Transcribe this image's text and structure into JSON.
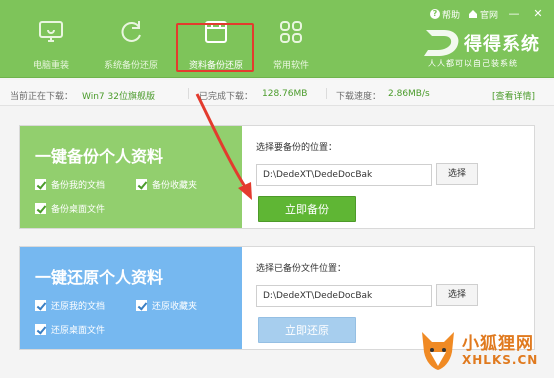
{
  "header": {
    "tools": [
      {
        "label": "电脑重装",
        "icon": "monitor-icon",
        "active": false
      },
      {
        "label": "系统备份还原",
        "icon": "refresh-icon",
        "active": false
      },
      {
        "label": "资料备份还原",
        "icon": "folder-icon",
        "active": true
      },
      {
        "label": "常用软件",
        "icon": "apps-grid-icon",
        "active": false
      }
    ],
    "topbar": {
      "help": "帮助",
      "site": "官网",
      "minimize": "—",
      "close": "✕"
    },
    "logo": {
      "main": "得得系统",
      "sub": "人人都可以自己装系统"
    }
  },
  "status": {
    "downloading_label": "当前正在下载：",
    "downloading_value": "Win7 32位旗舰版",
    "downloaded_label": "已完成下载：",
    "downloaded_value": "128.76MB",
    "speed_label": "下载速度：",
    "speed_value": "2.86MB/s",
    "detail_link": "[查看详情]"
  },
  "backup": {
    "title": "一键备份个人资料",
    "options": [
      "备份我的文档",
      "备份收藏夹",
      "备份桌面文件"
    ],
    "location_label": "选择要备份的位置：",
    "path": "D:\\DedeXT\\DedeDocBak",
    "choose_label": "选择",
    "action_label": "立即备份"
  },
  "restore": {
    "title": "一键还原个人资料",
    "options": [
      "还原我的文档",
      "还原收藏夹",
      "还原桌面文件"
    ],
    "location_label": "选择已备份文件位置：",
    "path": "D:\\DedeXT\\DedeDocBak",
    "choose_label": "选择",
    "action_label": "立即还原"
  },
  "watermark": {
    "cn": "小狐狸网",
    "en": "XHLKS.CN"
  },
  "colors": {
    "header_green": "#7ec45a",
    "backup_green": "#92cf6e",
    "restore_blue": "#76b8f0",
    "highlight_red": "#e33b2e",
    "watermark_orange": "#e07a1f"
  }
}
